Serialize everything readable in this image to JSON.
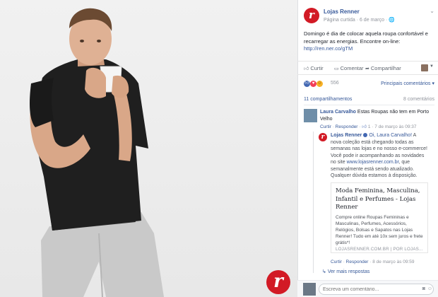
{
  "page": {
    "name": "Lojas Renner",
    "meta": "Página curtida · 6 de março · ",
    "globe": "🌐",
    "logo_letter": "r"
  },
  "post": {
    "text": "Domingo é dia de colocar aquela roupa confortável e recarregar as energias. Encontre on-line:",
    "link": "http://ren.ner.co/gTM"
  },
  "actions": {
    "like": "Curtir",
    "comment": "Comentar",
    "share": "Compartilhar"
  },
  "reactions": {
    "count": "556",
    "ranking_label": "Principais comentários ▾"
  },
  "stats": {
    "shares": "11 compartilhamentos",
    "comments": "8 comentários"
  },
  "comments": [
    {
      "author": "Laura Carvalho",
      "text": "Estas Roupas não tem em Porto Velho",
      "like": "Curtir",
      "reply": "Responder",
      "likes": "1",
      "date": "7 de março às 09:37"
    }
  ],
  "reply": {
    "author": "Lojas Renner",
    "mention": "Oi, Laura Carvalho!",
    "text": " A nova coleção está chegando todas as semanas nas lojas e no nosso e-commerce! Você pode ir acompanhando as novidades no site ",
    "site": "www.lojasrenner.com.br",
    "text2": ", que semanalmente está sendo atualizado. Qualquer dúvida estamos à disposição.",
    "like": "Curtir",
    "reply": "Responder",
    "date": "8 de março às 09:59"
  },
  "link_preview": {
    "title": "Moda Feminina, Masculina, Infantil e Perfumes - Lojas Renner",
    "description": "Compre online Roupas Femininas e Masculinas, Perfumes, Acessórios, Relógios, Bolsas e Sapatos nas Lojas Renner! Tudo em até 10x sem juros e frete grátis*!",
    "domain": "LOJASRENNER.COM.BR | POR LOJAS..."
  },
  "more_replies": "Ver mais respostas",
  "composer": {
    "placeholder": "Escreva um comentário..."
  },
  "colors": {
    "brand": "#d21a25",
    "link": "#365899",
    "like_blue": "#4267b2",
    "love_red": "#f33e58",
    "haha_yellow": "#f7b125"
  }
}
